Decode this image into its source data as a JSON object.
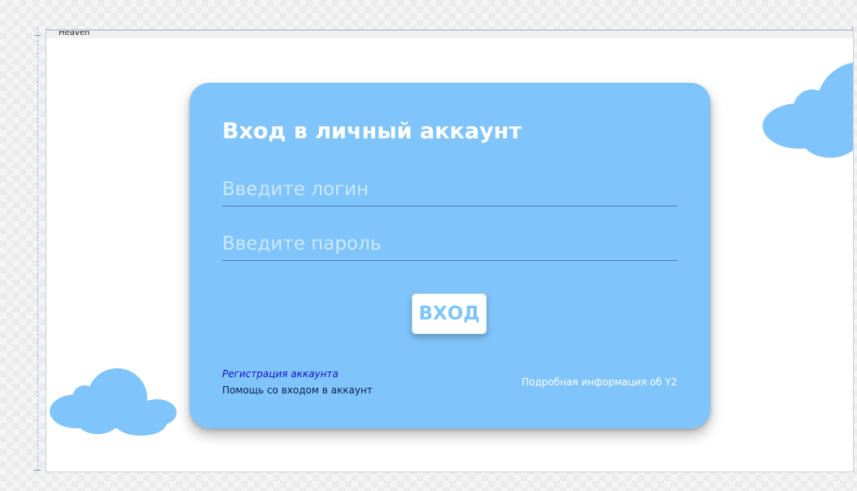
{
  "window": {
    "title": "Heaven"
  },
  "login": {
    "heading": "Вход в личный аккаунт",
    "login_placeholder": "Введите логин",
    "password_placeholder": "Введите пароль",
    "login_value": "",
    "password_value": "",
    "submit_label": "ВХОД"
  },
  "links": {
    "register": "Регистрация аккаунта",
    "help": "Помощь со входом в аккаунт",
    "info": "Подробная информация об Y2"
  },
  "colors": {
    "card": "#7fc4fa",
    "cloud": "#7fc4fa",
    "register_link": "#1212c8",
    "help_link": "#0b1e4a",
    "underline": "#4f77b3"
  },
  "icons": [
    "cloud-icon-top-right",
    "cloud-icon-bottom-left"
  ]
}
